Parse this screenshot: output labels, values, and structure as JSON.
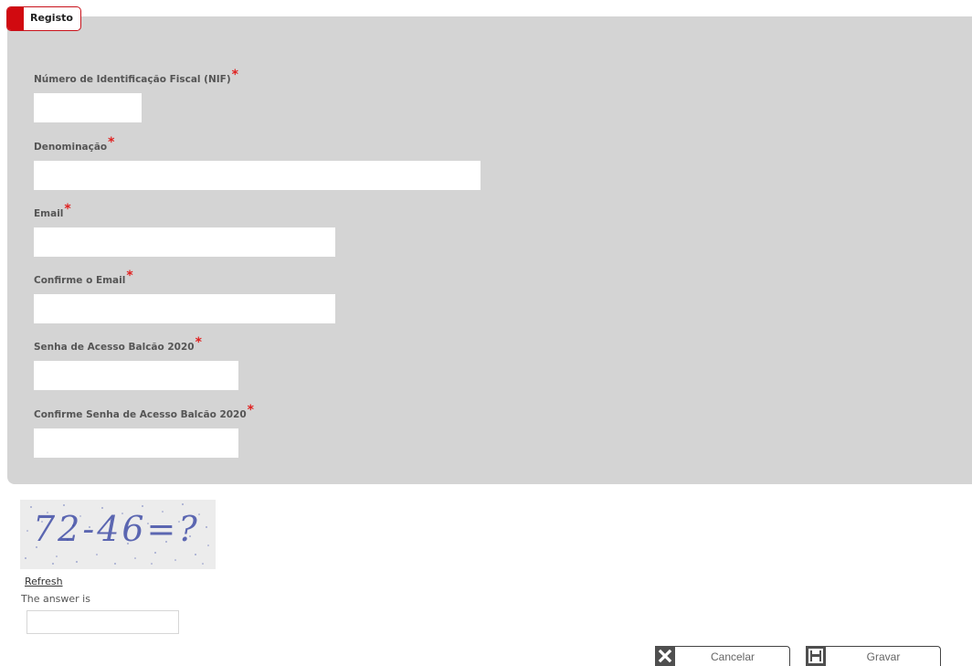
{
  "tab": {
    "label": "Registo"
  },
  "form": {
    "required_marker": "*",
    "fields": [
      {
        "label": "Número de Identificação Fiscal (NIF)",
        "value": ""
      },
      {
        "label": "Denominação",
        "value": ""
      },
      {
        "label": "Email",
        "value": ""
      },
      {
        "label": "Confirme o Email",
        "value": ""
      },
      {
        "label": "Senha de Acesso Balcão 2020",
        "value": ""
      },
      {
        "label": "Confirme Senha de Acesso Balcão 2020",
        "value": ""
      }
    ]
  },
  "captcha": {
    "image_text": "72-46=?",
    "refresh_label": "Refresh",
    "answer_label": "The answer is",
    "answer_value": ""
  },
  "actions": {
    "cancel_label": "Cancelar",
    "cancel_icon": "close-icon",
    "save_label": "Gravar",
    "save_icon": "save-icon"
  },
  "colors": {
    "accent": "#d10a10",
    "panel_bg": "#d4d4d4",
    "required": "#e0201f",
    "captcha_text": "#2b3a9e"
  }
}
